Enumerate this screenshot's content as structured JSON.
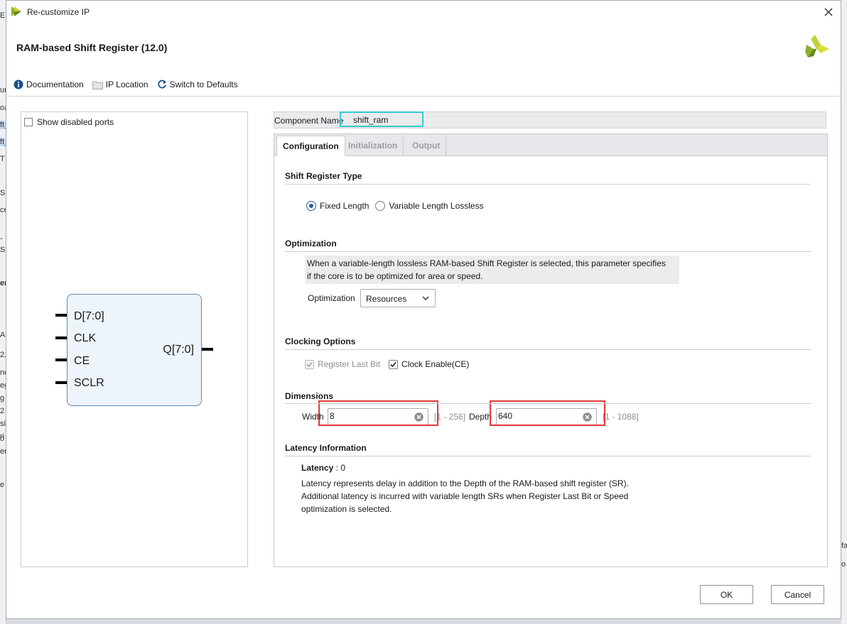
{
  "window": {
    "title": "Re-customize IP",
    "ip_title": "RAM-based Shift Register (12.0)"
  },
  "toolbar": {
    "documentation": "Documentation",
    "ip_location": "IP Location",
    "switch_defaults": "Switch to Defaults"
  },
  "symbol_panel": {
    "show_disabled_ports": "Show disabled ports",
    "inputs": [
      "D[7:0]",
      "CLK",
      "CE",
      "SCLR"
    ],
    "output": "Q[7:0]"
  },
  "component": {
    "label": "Component Name",
    "value": "shift_ram"
  },
  "tabs": [
    {
      "label": "Configuration",
      "active": true
    },
    {
      "label": "Initialization",
      "active": false
    },
    {
      "label": "Output",
      "active": false
    }
  ],
  "shift_register_type": {
    "title": "Shift Register Type",
    "options": [
      "Fixed Length",
      "Variable Length Lossless"
    ],
    "selected": "Fixed Length"
  },
  "optimization": {
    "title": "Optimization",
    "desc_line1": "When a variable-length lossless RAM-based Shift Register is selected, this parameter specifies",
    "desc_line2": "if the core is to be optimized for area or speed.",
    "label": "Optimization",
    "value": "Resources"
  },
  "clocking": {
    "title": "Clocking Options",
    "register_last_bit": "Register Last Bit",
    "clock_enable": "Clock Enable(CE)"
  },
  "dimensions": {
    "title": "Dimensions",
    "width_label": "Width",
    "width_value": "8",
    "width_range": "[1 - 256]",
    "depth_label": "Depth",
    "depth_value": "640",
    "depth_range": "[1 - 1088]"
  },
  "latency": {
    "title": "Latency Information",
    "label": "Latency",
    "value": ": 0",
    "line1": "Latency represents delay in addition to the Depth of the RAM-based shift register (SR).",
    "line2": "Additional latency is incurred with variable length SRs when Register Last Bit or Speed",
    "line3": "optimization is selected."
  },
  "buttons": {
    "ok": "OK",
    "cancel": "Cancel"
  },
  "colors": {
    "accent": "#2a5fa0",
    "highlight_cyan": "#36c8cc",
    "highlight_red": "#e03a3a"
  },
  "background_fragments": {
    "left": [
      "ER",
      "ur",
      "oa",
      "ft_",
      "ft_",
      "T",
      "S",
      "ce",
      "-",
      "Sc",
      "er",
      "A",
      "2.",
      "ne",
      "eg",
      "g",
      "2",
      "si",
      "ri",
      "o",
      "er",
      "e"
    ],
    "right": [
      "fa",
      "o"
    ]
  }
}
